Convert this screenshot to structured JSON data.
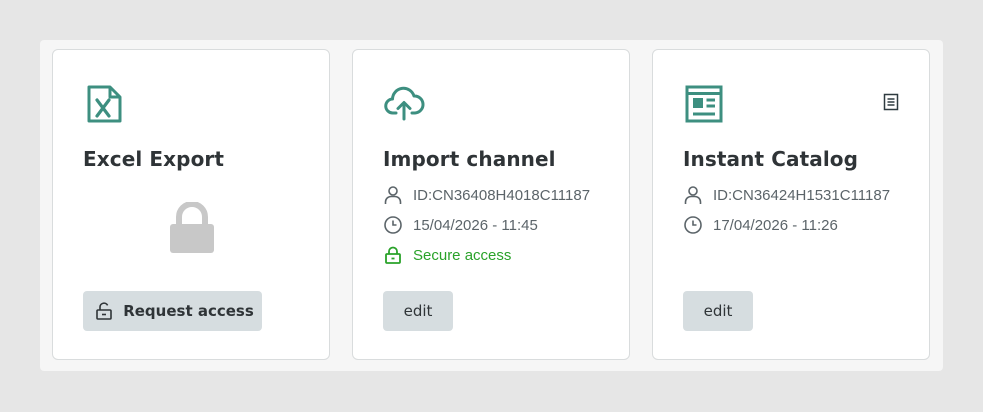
{
  "colors": {
    "accent": "#3d8f80",
    "secure": "#2aa22a",
    "muted": "#5b6469",
    "button_bg": "#d6dde0",
    "lock_gray": "#c8c8c8"
  },
  "cards": [
    {
      "icon": "excel-file-icon",
      "title": "Excel Export",
      "locked": true,
      "lock_icon": "lock-icon",
      "button": {
        "icon": "unlock-icon",
        "label": "Request access"
      }
    },
    {
      "icon": "cloud-upload-icon",
      "title": "Import channel",
      "id_icon": "user-icon",
      "id": "ID:CN36408H4018C11187",
      "date_icon": "clock-icon",
      "date": "15/04/2026 - 11:45",
      "secure_icon": "lock-icon",
      "secure": "Secure access",
      "button": {
        "label": "edit"
      }
    },
    {
      "icon": "catalog-icon",
      "title": "Instant Catalog",
      "corner_icon": "document-icon",
      "id_icon": "user-icon",
      "id": "ID:CN36424H1531C11187",
      "date_icon": "clock-icon",
      "date": "17/04/2026 - 11:26",
      "button": {
        "label": "edit"
      }
    }
  ]
}
